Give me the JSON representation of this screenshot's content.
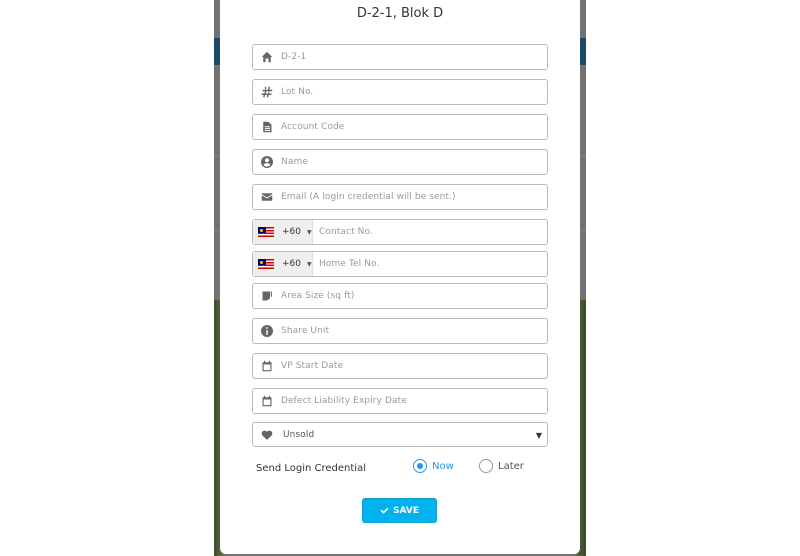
{
  "modal": {
    "title": "D-2-1, Blok D"
  },
  "form": {
    "fields": [
      {
        "icon": "home-icon",
        "placeholder": "D-2-1"
      },
      {
        "icon": "hash-icon",
        "placeholder": "Lot No."
      },
      {
        "icon": "document-icon",
        "placeholder": "Account Code"
      },
      {
        "icon": "user-icon",
        "placeholder": "Name"
      },
      {
        "icon": "envelope-icon",
        "placeholder": "Email (A login credential will be sent.)"
      },
      {
        "icon": "flag-my-icon",
        "country_code": "+60",
        "placeholder": "Contact No."
      },
      {
        "icon": "flag-my-icon",
        "country_code": "+60",
        "placeholder": "Home Tel No."
      },
      {
        "icon": "area-icon",
        "placeholder": "Area Size (sq ft)"
      },
      {
        "icon": "info-icon",
        "placeholder": "Share Unit"
      },
      {
        "icon": "calendar-icon",
        "placeholder": "VP Start Date"
      },
      {
        "icon": "calendar-icon",
        "placeholder": "Defect Liability Expiry Date"
      }
    ],
    "status_select": {
      "icon": "heart-icon",
      "selected": "Unsold"
    },
    "send_login": {
      "label": "Send Login Credential",
      "options": [
        {
          "label": "Now",
          "checked": true
        },
        {
          "label": "Later",
          "checked": false
        }
      ]
    },
    "save_label": "SAVE"
  },
  "colors": {
    "accent": "#00b2ee",
    "radio_active": "#2196f3",
    "backdrop": "#727272"
  }
}
